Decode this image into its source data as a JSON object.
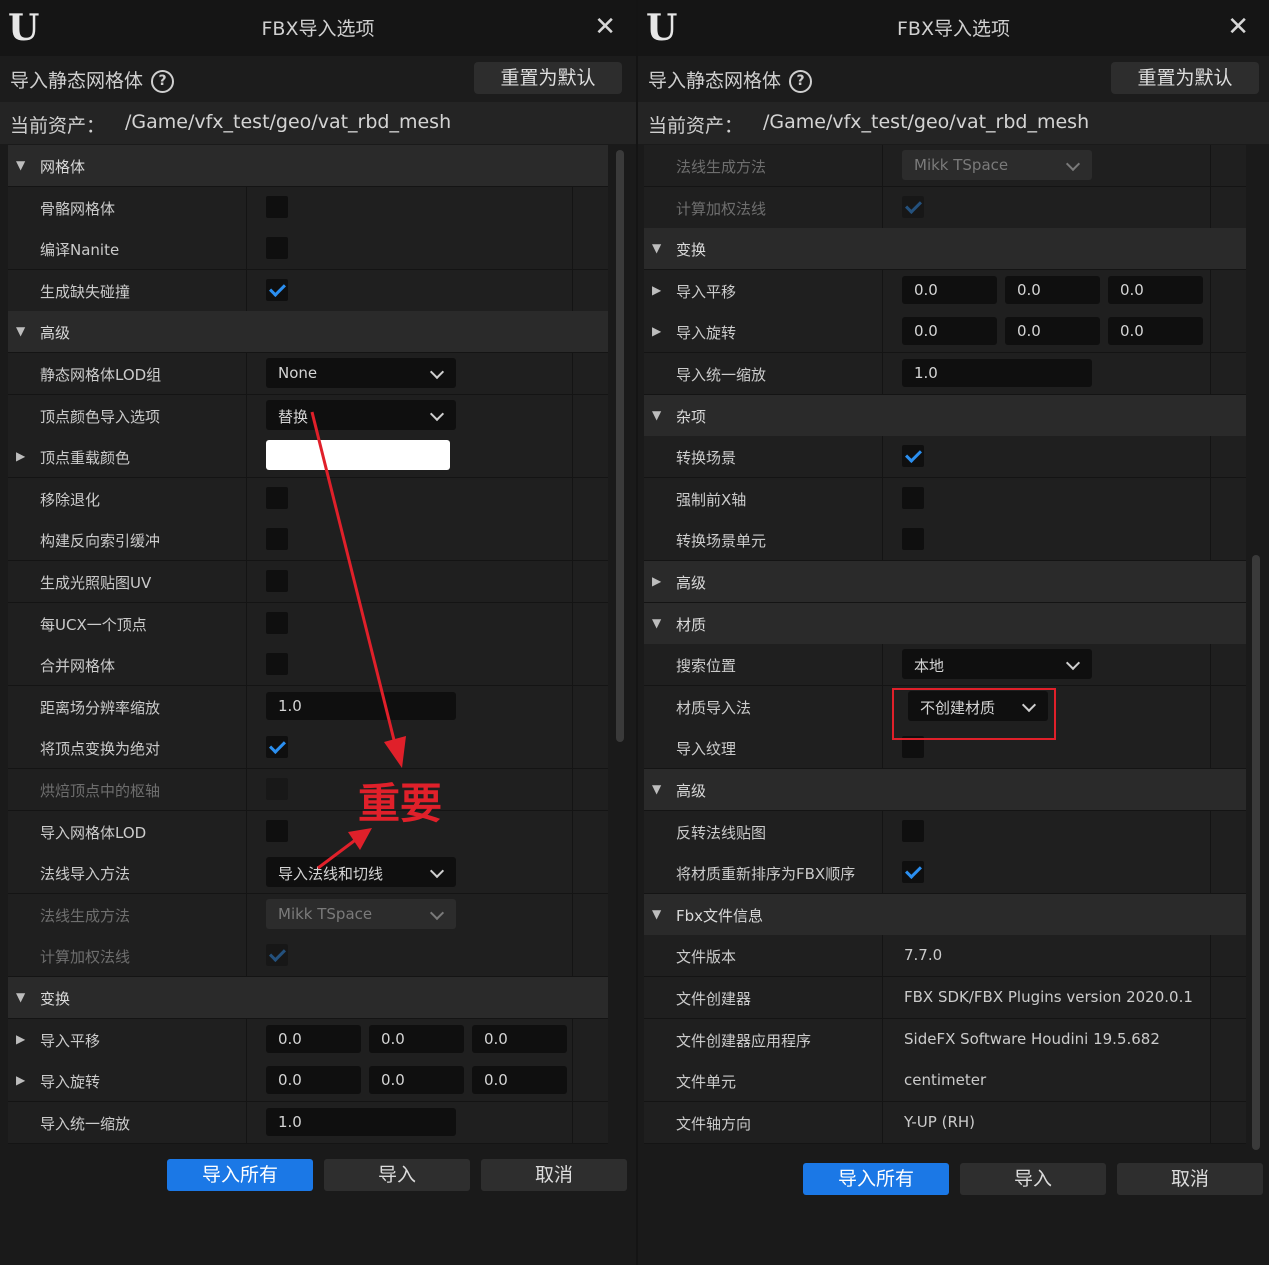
{
  "dialogs": [
    {
      "title": "FBX导入选项",
      "subheading": "导入静态网格体",
      "reset_label": "重置为默认",
      "asset_label": "当前资产：",
      "asset_path": "/Game/vfx_test/geo/vat_rbd_mesh",
      "rows": [
        {
          "kind": "cat",
          "caret": "▼",
          "label": "网格体"
        },
        {
          "kind": "check",
          "label": "骨骼网格体",
          "checked": false
        },
        {
          "kind": "check",
          "label": "编译Nanite",
          "checked": false
        },
        {
          "kind": "check",
          "label": "生成缺失碰撞",
          "checked": true
        },
        {
          "kind": "cat",
          "caret": "▼",
          "label": "高级"
        },
        {
          "kind": "combo",
          "label": "静态网格体LOD组",
          "value": "None"
        },
        {
          "kind": "combo",
          "label": "顶点颜色导入选项",
          "value": "替换"
        },
        {
          "kind": "color",
          "caret": "▶",
          "label": "顶点重载颜色"
        },
        {
          "kind": "check",
          "label": "移除退化",
          "checked": false
        },
        {
          "kind": "check",
          "label": "构建反向索引缓冲",
          "checked": false
        },
        {
          "kind": "check",
          "label": "生成光照贴图UV",
          "checked": false
        },
        {
          "kind": "check",
          "label": "每UCX一个顶点",
          "checked": false
        },
        {
          "kind": "check",
          "label": "合并网格体",
          "checked": false
        },
        {
          "kind": "num",
          "label": "距离场分辨率缩放",
          "value": "1.0"
        },
        {
          "kind": "check",
          "label": "将顶点变换为绝对",
          "checked": true
        },
        {
          "kind": "check",
          "label": "烘焙顶点中的枢轴",
          "checked": false,
          "disabled": true
        },
        {
          "kind": "check",
          "label": "导入网格体LOD",
          "checked": false
        },
        {
          "kind": "combo",
          "label": "法线导入方法",
          "value": "导入法线和切线"
        },
        {
          "kind": "combo",
          "label": "法线生成方法",
          "value": "Mikk TSpace",
          "disabled": true
        },
        {
          "kind": "check",
          "label": "计算加权法线",
          "checked": true,
          "disabled": true
        },
        {
          "kind": "cat",
          "caret": "▼",
          "label": "变换"
        },
        {
          "kind": "vec3",
          "caret": "▶",
          "label": "导入平移",
          "values": [
            "0.0",
            "0.0",
            "0.0"
          ]
        },
        {
          "kind": "vec3",
          "caret": "▶",
          "label": "导入旋转",
          "values": [
            "0.0",
            "0.0",
            "0.0"
          ]
        },
        {
          "kind": "num",
          "label": "导入统一缩放",
          "value": "1.0"
        }
      ],
      "buttons": {
        "import_all": "导入所有",
        "import": "导入",
        "cancel": "取消"
      }
    },
    {
      "title": "FBX导入选项",
      "subheading": "导入静态网格体",
      "reset_label": "重置为默认",
      "asset_label": "当前资产：",
      "asset_path": "/Game/vfx_test/geo/vat_rbd_mesh",
      "rows": [
        {
          "kind": "combo",
          "label": "法线生成方法",
          "value": "Mikk TSpace",
          "disabled": true
        },
        {
          "kind": "check",
          "label": "计算加权法线",
          "checked": true,
          "disabled": true
        },
        {
          "kind": "cat",
          "caret": "▼",
          "label": "变换"
        },
        {
          "kind": "vec3",
          "caret": "▶",
          "label": "导入平移",
          "values": [
            "0.0",
            "0.0",
            "0.0"
          ]
        },
        {
          "kind": "vec3",
          "caret": "▶",
          "label": "导入旋转",
          "values": [
            "0.0",
            "0.0",
            "0.0"
          ]
        },
        {
          "kind": "num",
          "label": "导入统一缩放",
          "value": "1.0"
        },
        {
          "kind": "cat",
          "caret": "▼",
          "label": "杂项"
        },
        {
          "kind": "check",
          "label": "转换场景",
          "checked": true
        },
        {
          "kind": "check",
          "label": "强制前X轴",
          "checked": false
        },
        {
          "kind": "check",
          "label": "转换场景单元",
          "checked": false
        },
        {
          "kind": "cat",
          "caret": "▶",
          "label": "高级"
        },
        {
          "kind": "cat",
          "caret": "▼",
          "label": "材质"
        },
        {
          "kind": "combo",
          "label": "搜索位置",
          "value": "本地"
        },
        {
          "kind": "combo",
          "label": "材质导入法",
          "value": "不创建材质",
          "highlight": true
        },
        {
          "kind": "check",
          "label": "导入纹理",
          "checked": false
        },
        {
          "kind": "cat",
          "caret": "▼",
          "label": "高级"
        },
        {
          "kind": "check",
          "label": "反转法线贴图",
          "checked": false
        },
        {
          "kind": "check",
          "label": "将材质重新排序为FBX顺序",
          "checked": true
        },
        {
          "kind": "cat",
          "caret": "▼",
          "label": "Fbx文件信息"
        },
        {
          "kind": "text",
          "label": "文件版本",
          "value": "7.7.0"
        },
        {
          "kind": "text",
          "label": "文件创建器",
          "value": "FBX SDK/FBX Plugins version 2020.0.1"
        },
        {
          "kind": "text",
          "label": "文件创建器应用程序",
          "value": "SideFX Software Houdini 19.5.682"
        },
        {
          "kind": "text",
          "label": "文件单元",
          "value": "centimeter"
        },
        {
          "kind": "text",
          "label": "文件轴方向",
          "value": "Y-UP (RH)"
        }
      ],
      "buttons": {
        "import_all": "导入所有",
        "import": "导入",
        "cancel": "取消"
      }
    }
  ],
  "annotation": {
    "text": "重要",
    "color": "#e0202a"
  },
  "colors": {
    "accent": "#1b78e6",
    "check": "#2b8ff0",
    "annotation": "#e0202a"
  }
}
